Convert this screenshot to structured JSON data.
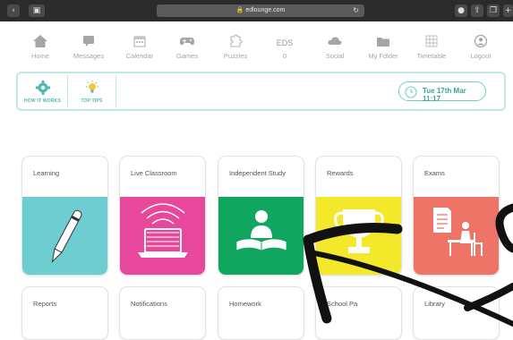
{
  "browser": {
    "url": "edlounge.com"
  },
  "nav": {
    "items": [
      {
        "label": "Home",
        "icon": "home-icon"
      },
      {
        "label": "Messages",
        "icon": "messages-icon"
      },
      {
        "label": "Calendar",
        "icon": "calendar-icon"
      },
      {
        "label": "Games",
        "icon": "gamepad-icon"
      },
      {
        "label": "Puzzles",
        "icon": "puzzle-icon"
      },
      {
        "label": "0",
        "top": "EDS",
        "icon": "eds-icon"
      },
      {
        "label": "Social",
        "icon": "cloud-icon"
      },
      {
        "label": "My Folder",
        "icon": "folder-icon"
      },
      {
        "label": "Timetable",
        "icon": "timetable-icon"
      },
      {
        "label": "Logout",
        "icon": "logout-icon"
      }
    ]
  },
  "info": {
    "how_it_works": "HOW IT WORKS",
    "top_tips": "TOP TIPS",
    "datetime": "Tue 17th Mar 11:17"
  },
  "tiles": {
    "row1": [
      {
        "label": "Learning",
        "color": "#6dcdd1"
      },
      {
        "label": "Live Classroom",
        "color": "#e8489b"
      },
      {
        "label": "Independent Study",
        "color": "#10a660"
      },
      {
        "label": "Rewards",
        "color": "#f4e82a"
      },
      {
        "label": "Exams",
        "color": "#ee7468"
      }
    ],
    "row2": [
      {
        "label": "Reports"
      },
      {
        "label": "Notifications"
      },
      {
        "label": "Homework"
      },
      {
        "label": "School Pa"
      },
      {
        "label": "Library"
      }
    ]
  }
}
